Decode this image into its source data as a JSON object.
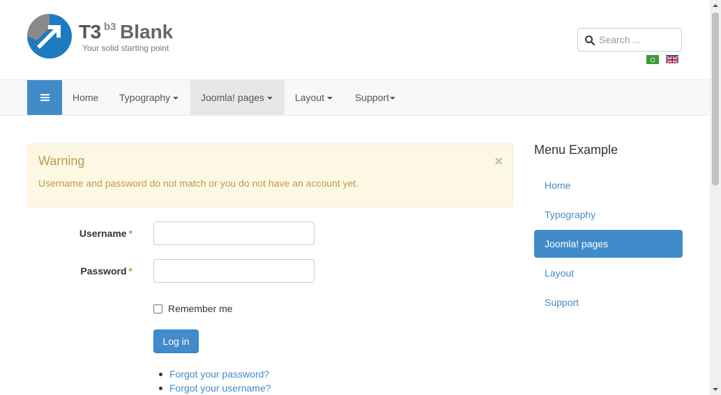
{
  "header": {
    "logo_main": "T3",
    "logo_sup": "b3",
    "logo_name": "Blank",
    "slogan": "Your solid starting point",
    "search_placeholder": "Search ...",
    "languages": [
      "ar",
      "en"
    ]
  },
  "nav": {
    "toggle_icon": "hamburger-icon",
    "items": [
      {
        "label": "Home",
        "dropdown": false
      },
      {
        "label": "Typography",
        "dropdown": true
      },
      {
        "label": "Joomla! pages",
        "dropdown": true,
        "active": true
      },
      {
        "label": "Layout",
        "dropdown": true
      },
      {
        "label": "Support",
        "dropdown": true
      }
    ]
  },
  "alert": {
    "title": "Warning",
    "message": "Username and password do not match or you do not have an account yet.",
    "close": "×"
  },
  "form": {
    "username_label": "Username",
    "password_label": "Password",
    "required_mark": "*",
    "username_value": "",
    "password_value": "",
    "remember_label": "Remember me",
    "remember_checked": false,
    "login_button": "Log in",
    "links": [
      "Forgot your password?",
      "Forgot your username?"
    ]
  },
  "sidebar": {
    "title": "Menu Example",
    "items": [
      {
        "label": "Home"
      },
      {
        "label": "Typography"
      },
      {
        "label": "Joomla! pages",
        "active": true
      },
      {
        "label": "Layout"
      },
      {
        "label": "Support"
      }
    ]
  },
  "colors": {
    "primary": "#428bca",
    "warning_bg": "#fcf8e3",
    "warning_text": "#c09853",
    "nav_bg": "#f8f8f8"
  }
}
